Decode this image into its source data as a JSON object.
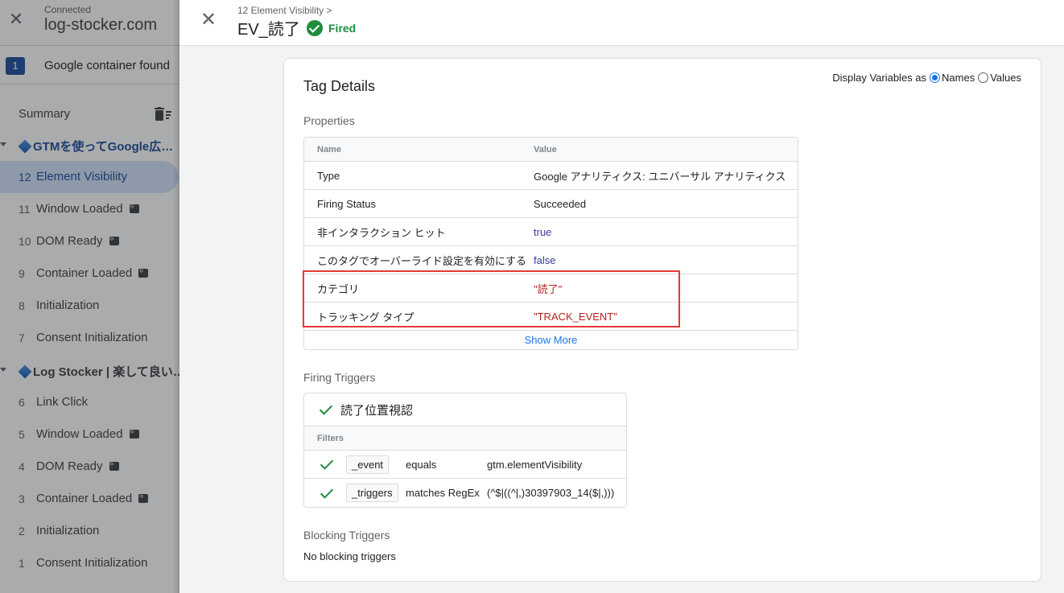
{
  "sidebar": {
    "connected_label": "Connected",
    "domain": "log-stocker.com",
    "container_badge": "1",
    "container_label": "Google container found",
    "summary_label": "Summary",
    "groups": [
      {
        "label": "GTMを使ってGoogle広…",
        "items": [
          {
            "num": "12",
            "label": "Element Visibility",
            "active": true,
            "code": false
          },
          {
            "num": "11",
            "label": "Window Loaded",
            "code": true
          },
          {
            "num": "10",
            "label": "DOM Ready",
            "code": true
          },
          {
            "num": "9",
            "label": "Container Loaded",
            "code": true
          },
          {
            "num": "8",
            "label": "Initialization",
            "code": false
          },
          {
            "num": "7",
            "label": "Consent Initialization",
            "code": false
          }
        ]
      },
      {
        "label": "Log Stocker | 楽して良い…",
        "items": [
          {
            "num": "6",
            "label": "Link Click",
            "code": false
          },
          {
            "num": "5",
            "label": "Window Loaded",
            "code": true
          },
          {
            "num": "4",
            "label": "DOM Ready",
            "code": true
          },
          {
            "num": "3",
            "label": "Container Loaded",
            "code": true
          },
          {
            "num": "2",
            "label": "Initialization",
            "code": false
          },
          {
            "num": "1",
            "label": "Consent Initialization",
            "code": false
          }
        ]
      }
    ]
  },
  "header": {
    "breadcrumb": "12 Element Visibility >",
    "title": "EV_読了",
    "status": "Fired"
  },
  "tag_details": {
    "title": "Tag Details",
    "display_vars_label": "Display Variables as",
    "options": [
      "Names",
      "Values"
    ],
    "selected_option": "Names",
    "properties_title": "Properties",
    "columns": [
      "Name",
      "Value"
    ],
    "rows": [
      {
        "name": "Type",
        "value": "Google アナリティクス: ユニバーサル アナリティクス"
      },
      {
        "name": "Firing Status",
        "value": "Succeeded"
      },
      {
        "name": "非インタラクション ヒット",
        "value": "true"
      },
      {
        "name": "このタグでオーバーライド設定を有効にする",
        "value": "false"
      },
      {
        "name": "カテゴリ",
        "value": "\"読了\""
      },
      {
        "name": "トラッキング タイプ",
        "value": "\"TRACK_EVENT\""
      }
    ],
    "show_more": "Show More",
    "firing_triggers_title": "Firing Triggers",
    "trigger_name": "読了位置視認",
    "filters_label": "Filters",
    "filters": [
      {
        "variable": "_event",
        "operator": "equals",
        "value": "gtm.elementVisibility"
      },
      {
        "variable": "_triggers",
        "operator": "matches RegEx",
        "value": "(^$|((^|,)30397903_14($|,)))"
      }
    ],
    "blocking_triggers_title": "Blocking Triggers",
    "no_blocking": "No blocking triggers"
  },
  "colors": {
    "accent": "#1a73e8",
    "fired_green": "#1e8e3e",
    "string_value": "#b3261e",
    "bool_value": "#3c3c9c",
    "highlight_box": "#e53935",
    "container_badge": "#1a4c9c"
  }
}
